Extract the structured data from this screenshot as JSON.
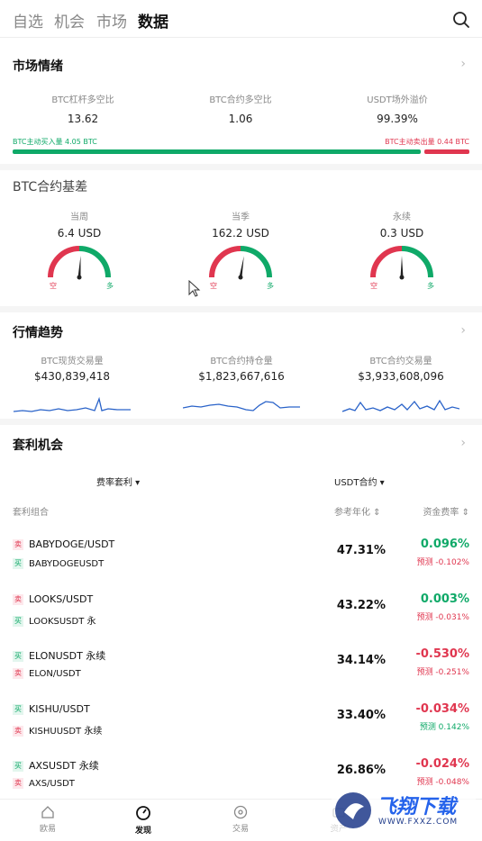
{
  "top_tabs": [
    "自选",
    "机会",
    "市场",
    "数据"
  ],
  "market_sentiment": {
    "title": "市场情绪",
    "stats": [
      {
        "label": "BTC杠杆多空比",
        "value": "13.62"
      },
      {
        "label": "BTC合约多空比",
        "value": "1.06"
      },
      {
        "label": "USDT场外溢价",
        "value": "99.39%"
      }
    ],
    "buy_label": "BTC主动买入量 4.05 BTC",
    "sell_label": "BTC主动卖出量 0.44 BTC",
    "buy_share": 0.9
  },
  "basis": {
    "title": "BTC合约基差",
    "gauges": [
      {
        "label": "当周",
        "value": "6.4 USD",
        "level": 0.52
      },
      {
        "label": "当季",
        "value": "162.2 USD",
        "level": 0.55
      },
      {
        "label": "永续",
        "value": "0.3 USD",
        "level": 0.5
      }
    ],
    "short_label": "空",
    "long_label": "多"
  },
  "trends": {
    "title": "行情趋势",
    "items": [
      {
        "label": "BTC现货交易量",
        "value": "$430,839,418"
      },
      {
        "label": "BTC合约持仓量",
        "value": "$1,823,667,616"
      },
      {
        "label": "BTC合约交易量",
        "value": "$3,933,608,096"
      }
    ]
  },
  "arbitrage": {
    "title": "套利机会",
    "filter_left": "费率套利 ▾",
    "filter_right": "USDT合约 ▾",
    "col_combo": "套利组合",
    "col_annual": "参考年化 ⇕",
    "col_rate": "资金费率 ⇕",
    "rows": [
      {
        "tag1": "卖",
        "pair1": "BABYDOGE/USDT",
        "tag2": "买",
        "pair2": "BABYDOGEUSDT",
        "annual": "47.31%",
        "rate": "0.096%",
        "pred": "预测 -0.102%"
      },
      {
        "tag1": "卖",
        "pair1": "LOOKS/USDT",
        "tag2": "买",
        "pair2": "LOOKSUSDT 永",
        "annual": "43.22%",
        "rate": "0.003%",
        "pred": "预测 -0.031%"
      },
      {
        "tag1": "买",
        "pair1": "ELONUSDT 永续",
        "tag2": "卖",
        "pair2": "ELON/USDT",
        "annual": "34.14%",
        "rate": "-0.530%",
        "pred": "预测 -0.251%"
      },
      {
        "tag1": "买",
        "pair1": "KISHU/USDT",
        "tag2": "卖",
        "pair2": "KISHUUSDT 永续",
        "annual": "33.40%",
        "rate": "-0.034%",
        "pred": "预测 0.142%"
      },
      {
        "tag1": "买",
        "pair1": "AXSUSDT 永续",
        "tag2": "卖",
        "pair2": "AXS/USDT",
        "annual": "26.86%",
        "rate": "-0.024%",
        "pred": "预测 -0.048%"
      }
    ]
  },
  "bottom_nav": [
    "欧易",
    "发现",
    "交易",
    "资产"
  ],
  "watermark": {
    "brand": "飞翔下载",
    "url": "WWW.FXXZ.COM"
  },
  "colors": {
    "up": "#0fa968",
    "down": "#e0364f",
    "line": "#2a63c9"
  }
}
